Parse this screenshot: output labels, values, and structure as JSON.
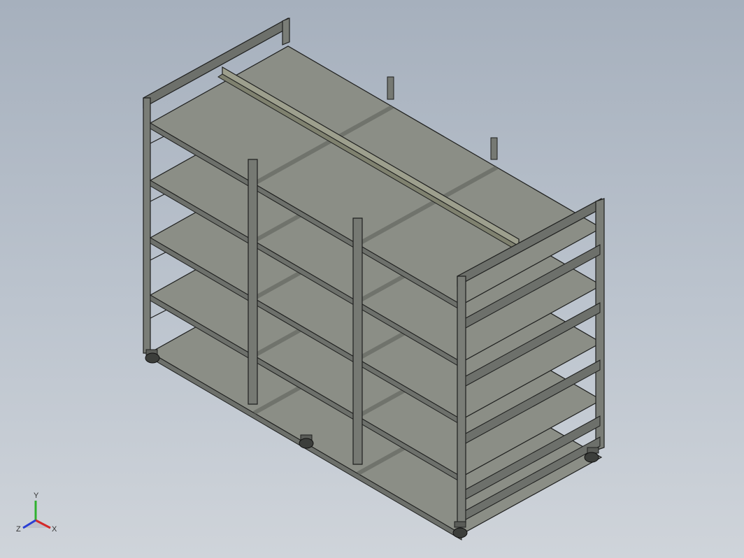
{
  "viewport": {
    "background_top": "#a6b0bd",
    "background_bottom": "#cfd4da"
  },
  "model": {
    "name": "shelving-rack-assembly",
    "shelf_count": 5,
    "bay_count": 3,
    "shelf_color": "#8b8e86",
    "shelf_edge_color": "#5b5d58",
    "frame_color": "#6d706b",
    "frame_edge_color": "#1e1f1e",
    "divider_color": "#9d9f8d"
  },
  "triad": {
    "x_label": "X",
    "y_label": "Y",
    "z_label": "Z",
    "x_color": "#d42a2a",
    "y_color": "#2fb12f",
    "z_color": "#2a3fd4"
  }
}
